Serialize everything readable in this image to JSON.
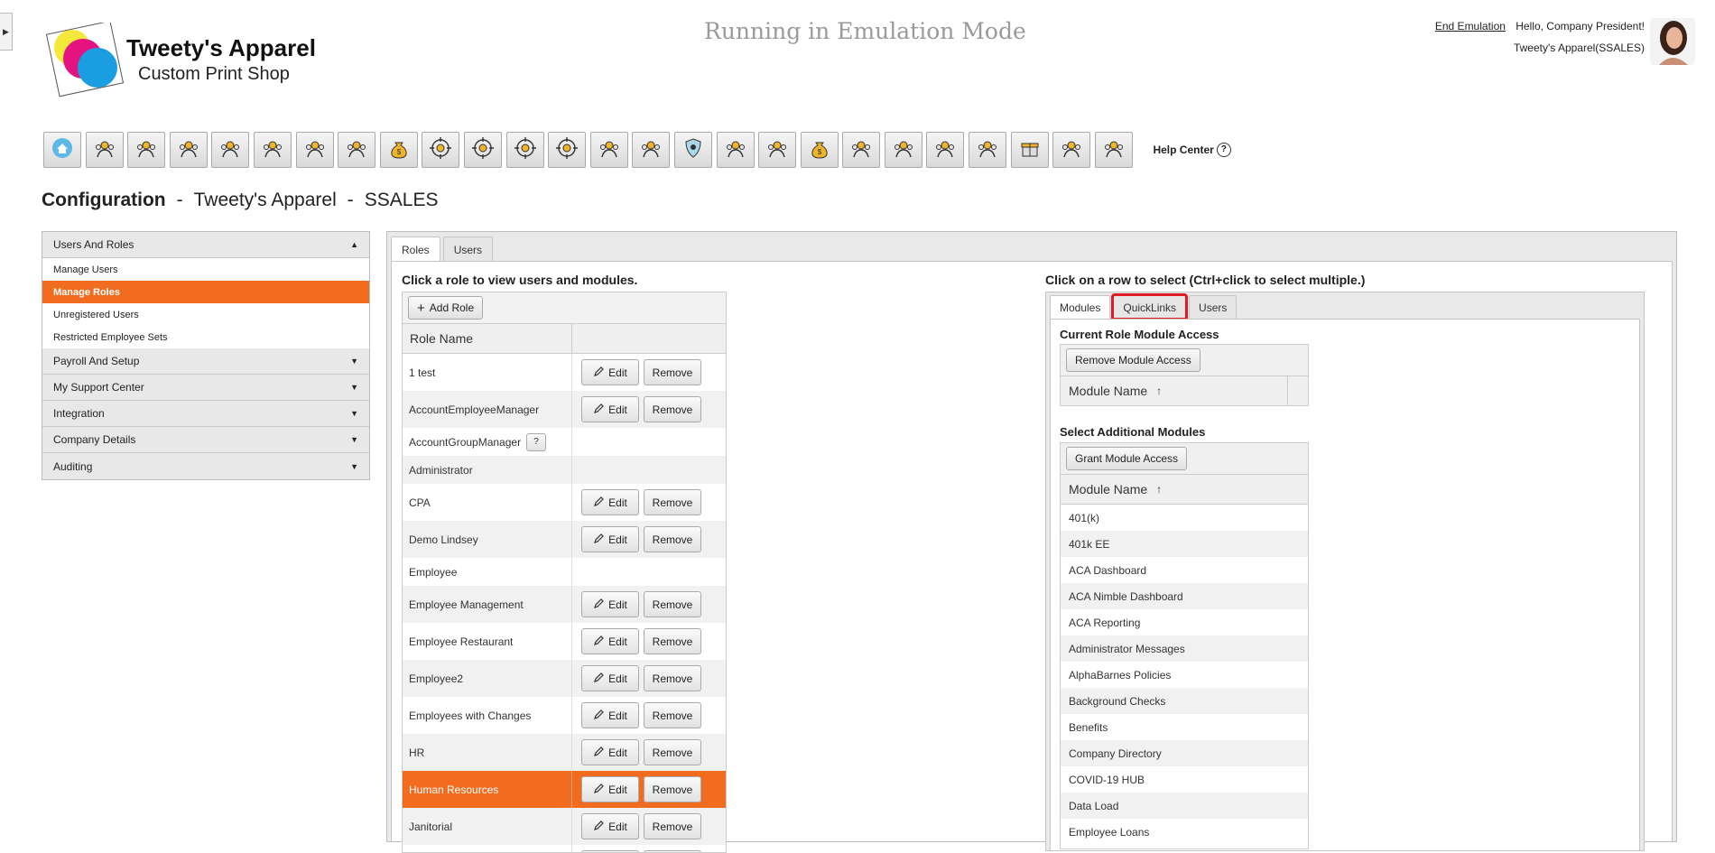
{
  "header": {
    "brand_name": "Tweety's Apparel",
    "brand_sub": "Custom Print Shop",
    "emulation_text": "Running in Emulation Mode",
    "end_emulation": "End Emulation",
    "greeting": "Hello, Company President!",
    "company": "Tweety's Apparel(SSALES)"
  },
  "toolbar": {
    "icons": [
      "home-icon",
      "award-icon",
      "people-gear-icon",
      "presentation-icon",
      "team-icon",
      "group-icon",
      "org-chart-icon",
      "document-icon",
      "money-bag-icon",
      "target-icon",
      "target-icon",
      "target-icon",
      "target-icon",
      "arrows-icon",
      "handshake-icon",
      "shield-icon",
      "search-money-icon",
      "scissors-icon",
      "money-bag-icon",
      "growth-icon",
      "handshake-icon",
      "coins-icon",
      "search-icon",
      "gift-icon",
      "group-icon",
      "handshake-icon"
    ],
    "help_center": "Help Center"
  },
  "page_title": {
    "section": "Configuration",
    "company": "Tweety's Apparel",
    "code": "SSALES",
    "separator": "-"
  },
  "sidebar": {
    "sections": [
      {
        "label": "Users And Roles",
        "expanded": true,
        "items": [
          {
            "label": "Manage Users",
            "active": false
          },
          {
            "label": "Manage Roles",
            "active": true
          },
          {
            "label": "Unregistered Users",
            "active": false
          },
          {
            "label": "Restricted Employee Sets",
            "active": false
          }
        ]
      },
      {
        "label": "Payroll And Setup",
        "expanded": false
      },
      {
        "label": "My Support Center",
        "expanded": false
      },
      {
        "label": "Integration",
        "expanded": false
      },
      {
        "label": "Company Details",
        "expanded": false
      },
      {
        "label": "Auditing",
        "expanded": false
      }
    ]
  },
  "main_tabs": [
    {
      "label": "Roles",
      "active": true
    },
    {
      "label": "Users",
      "active": false
    }
  ],
  "roles": {
    "heading": "Click a role to view users and modules.",
    "add_label": "Add Role",
    "column_header": "Role Name",
    "edit_label": "Edit",
    "remove_label": "Remove",
    "help_label": "?",
    "rows": [
      {
        "name": "1 test",
        "editable": true,
        "selected": false
      },
      {
        "name": "AccountEmployeeManager",
        "editable": true,
        "selected": false
      },
      {
        "name": "AccountGroupManager",
        "editable": false,
        "help": true,
        "selected": false
      },
      {
        "name": "Administrator",
        "editable": false,
        "selected": false
      },
      {
        "name": "CPA",
        "editable": true,
        "selected": false
      },
      {
        "name": "Demo Lindsey",
        "editable": true,
        "selected": false
      },
      {
        "name": "Employee",
        "editable": false,
        "selected": false
      },
      {
        "name": "Employee Management",
        "editable": true,
        "selected": false
      },
      {
        "name": "Employee Restaurant",
        "editable": true,
        "selected": false
      },
      {
        "name": "Employee2",
        "editable": true,
        "selected": false
      },
      {
        "name": "Employees with Changes",
        "editable": true,
        "selected": false
      },
      {
        "name": "HR",
        "editable": true,
        "selected": false
      },
      {
        "name": "Human Resources",
        "editable": true,
        "selected": true
      },
      {
        "name": "Janitorial",
        "editable": true,
        "selected": false
      },
      {
        "name": "",
        "editable": true,
        "selected": false
      }
    ]
  },
  "modules_panel": {
    "heading": "Click on a row to select (Ctrl+click to select multiple.)",
    "tabs": [
      {
        "label": "Modules",
        "active": true,
        "highlight": false
      },
      {
        "label": "QuickLinks",
        "active": false,
        "highlight": true
      },
      {
        "label": "Users",
        "active": false,
        "highlight": false
      }
    ],
    "current": {
      "title": "Current Role Module Access",
      "button": "Remove Module Access",
      "column": "Module Name",
      "sort_glyph": "↑"
    },
    "additional": {
      "title": "Select Additional Modules",
      "button": "Grant Module Access",
      "column": "Module Name",
      "sort_glyph": "↑",
      "items": [
        "401(k)",
        "401k EE",
        "ACA Dashboard",
        "ACA Nimble Dashboard",
        "ACA Reporting",
        "Administrator Messages",
        "AlphaBarnes Policies",
        "Background Checks",
        "Benefits",
        "Company Directory",
        "COVID-19 HUB",
        "Data Load",
        "Employee Loans"
      ]
    }
  },
  "colors": {
    "accent": "#f26c1f",
    "highlight": "#e01b24"
  }
}
